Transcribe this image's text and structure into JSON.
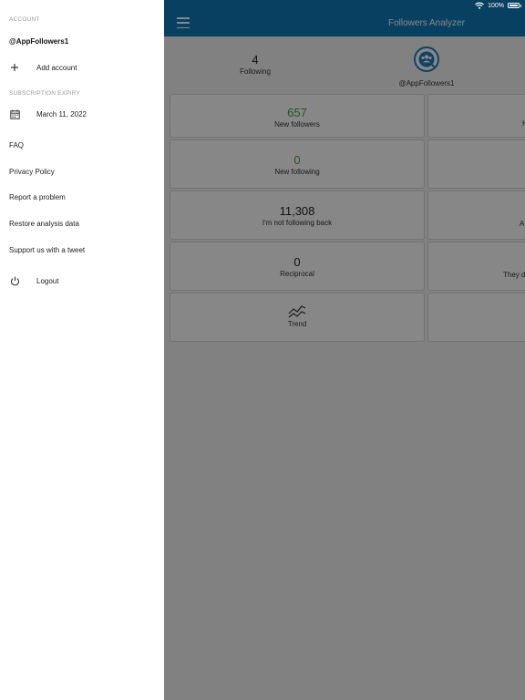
{
  "status_bar": {
    "battery": "100%"
  },
  "app": {
    "title": "Followers Analyzer",
    "following": {
      "count": "4",
      "label": "Following"
    },
    "profile": {
      "username": "@AppFollowers1"
    },
    "cards": {
      "new_followers": {
        "count": "657",
        "label": "New followers"
      },
      "new_following": {
        "count": "0",
        "label": "New following"
      },
      "not_following_back": {
        "count": "11,308",
        "label": "I'm not following back"
      },
      "reciprocal": {
        "count": "0",
        "label": "Reciprocal"
      },
      "trend": {
        "label": "Trend"
      },
      "right_partial": {
        "label_2": "H",
        "label_4": "A",
        "label_5": "They d"
      }
    },
    "colors": {
      "appbar": "#0f7ab8",
      "positive": "#3fa34d"
    }
  },
  "drawer": {
    "account_header": "ACCOUNT",
    "account_name": "@AppFollowers1",
    "add_account": "Add account",
    "subscription_header": "SUBSCRIPTION EXPIRY",
    "subscription_date": "March 11, 2022",
    "links": {
      "faq": "FAQ",
      "privacy": "Privacy Policy",
      "report": "Report a problem",
      "restore": "Restore analysis data",
      "support": "Support us with a tweet"
    },
    "logout": "Logout"
  }
}
